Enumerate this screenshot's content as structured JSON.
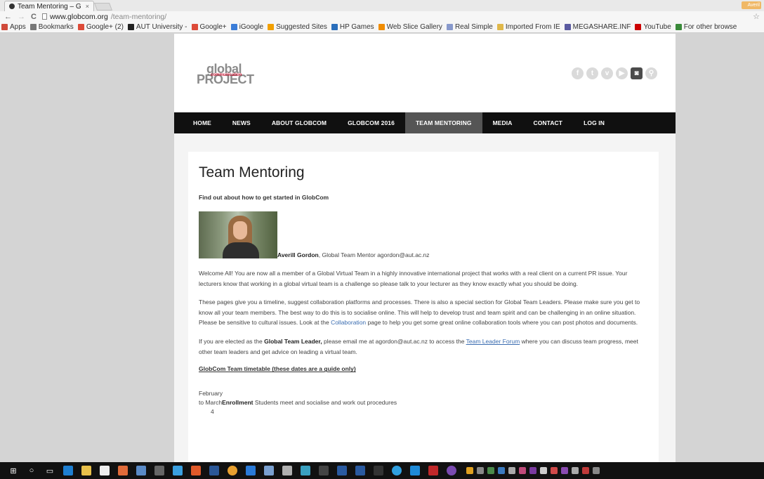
{
  "browser": {
    "tab_title": "Team Mentoring – G",
    "tab_close": "×",
    "user_chip": "Averil",
    "back": "←",
    "forward": "→",
    "reload": "C",
    "url_host": "www.globcom.org",
    "url_path": "/team-mentoring/",
    "star": "☆",
    "bookmarks": [
      {
        "label": "Apps",
        "color": "#d04a3a"
      },
      {
        "label": "Bookmarks",
        "color": "#777777"
      },
      {
        "label": "Google+ (2)",
        "color": "#dd4b39"
      },
      {
        "label": "AUT University -",
        "color": "#222222"
      },
      {
        "label": "Google+",
        "color": "#dd4b39"
      },
      {
        "label": "iGoogle",
        "color": "#3b7dd8"
      },
      {
        "label": "Suggested Sites",
        "color": "#f2a000"
      },
      {
        "label": "HP Games",
        "color": "#2a6ebb"
      },
      {
        "label": "Web Slice Gallery",
        "color": "#f08c00"
      },
      {
        "label": "Real Simple",
        "color": "#8899cc"
      },
      {
        "label": "Imported From IE",
        "color": "#e0b84a"
      },
      {
        "label": "MEGASHARE.INF",
        "color": "#5a5aa0"
      },
      {
        "label": "YouTube",
        "color": "#cc0000"
      },
      {
        "label": "For other browse",
        "color": "#3a8a3a"
      }
    ]
  },
  "site": {
    "logo_global": "global",
    "logo_project": "PROJECT",
    "logo_communication": "communication",
    "socials": [
      {
        "icon": "facebook-icon",
        "glyph": "f"
      },
      {
        "icon": "twitter-icon",
        "glyph": "t"
      },
      {
        "icon": "vimeo-icon",
        "glyph": "v"
      },
      {
        "icon": "youtube-icon",
        "glyph": "▶"
      },
      {
        "icon": "instagram-icon",
        "glyph": "◙"
      },
      {
        "icon": "search-icon",
        "glyph": "⚲"
      }
    ],
    "nav": [
      {
        "label": "HOME",
        "active": false
      },
      {
        "label": "NEWS",
        "active": false
      },
      {
        "label": "ABOUT GLOBCOM",
        "active": false
      },
      {
        "label": "GLOBCOM 2016",
        "active": false
      },
      {
        "label": "TEAM MENTORING",
        "active": true
      },
      {
        "label": "MEDIA",
        "active": false
      },
      {
        "label": "CONTACT",
        "active": false
      },
      {
        "label": "LOG IN",
        "active": false
      }
    ]
  },
  "content": {
    "title": "Team Mentoring",
    "subtitle": "Find out about how to get started in GlobCom",
    "mentor_name": "Averill Gordon",
    "mentor_rest": ", Global Team Mentor agordon@aut.ac.nz",
    "p1": "Welcome All!  You are now all a member of a Global Virtual Team in a highly innovative international project that works with a real client on a current PR issue.  Your lecturers know that working in a global virtual team is a challenge so please talk to your lecturer as they know exactly what you should be doing.",
    "p2a": "These pages  give you a timeline, suggest collaboration platforms and processes.  There is also a special section for Global Team Leaders.  Please make sure you get to know all your team members. The best way to do this is to socialise online.  This will help to develop trust and team spirit and can be challenging in an online situation. Please be sensitive to cultural issues.  Look at the ",
    "p2_link": "Collaboration",
    "p2b": " page to help you get some great online collaboration tools where you can post photos and documents.",
    "p3a": "If you are elected as the ",
    "p3_bold": "Global Team Leader,",
    "p3b": "  please email me at agordon@aut.ac.nz to access the ",
    "p3_link": "Team Leader Forum",
    "p3c": " where you can discuss team progress, meet other team leaders and get advice on leading a virtual team.",
    "timetable": "GlobCom Team timetable (these dates are a guide only)",
    "sched_month": "February",
    "sched_to": "to March",
    "sched_bold": "Enrollment",
    "sched_text": "  Students meet and socialise and work out procedures",
    "sched_num": "4"
  }
}
